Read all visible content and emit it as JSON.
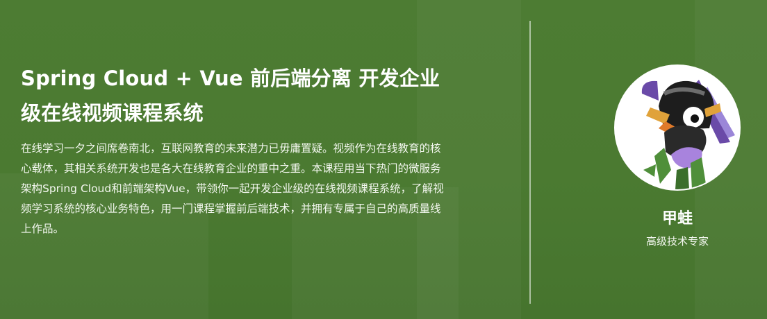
{
  "course": {
    "title": "Spring Cloud + Vue 前后端分离 开发企业级在线视频课程系统",
    "description": "在线学习一夕之间席卷南北，互联网教育的未来潜力已毋庸置疑。视频作为在线教育的核心载体，其相关系统开发也是各大在线教育企业的重中之重。本课程用当下热门的微服务架构Spring Cloud和前端架构Vue，带领你一起开发企业级的在线视频课程系统，了解视频学习系统的核心业务特色，用一门课程掌握前后端技术，并拥有专属于自己的高质量线上作品。"
  },
  "teacher": {
    "name": "甲蛙",
    "role": "高级技术专家",
    "avatar_icon": "cartoon-penguin-knight-avatar"
  },
  "colors": {
    "background": "#4b7a31",
    "text": "#ffffff",
    "divider": "rgba(255,255,255,0.55)"
  }
}
